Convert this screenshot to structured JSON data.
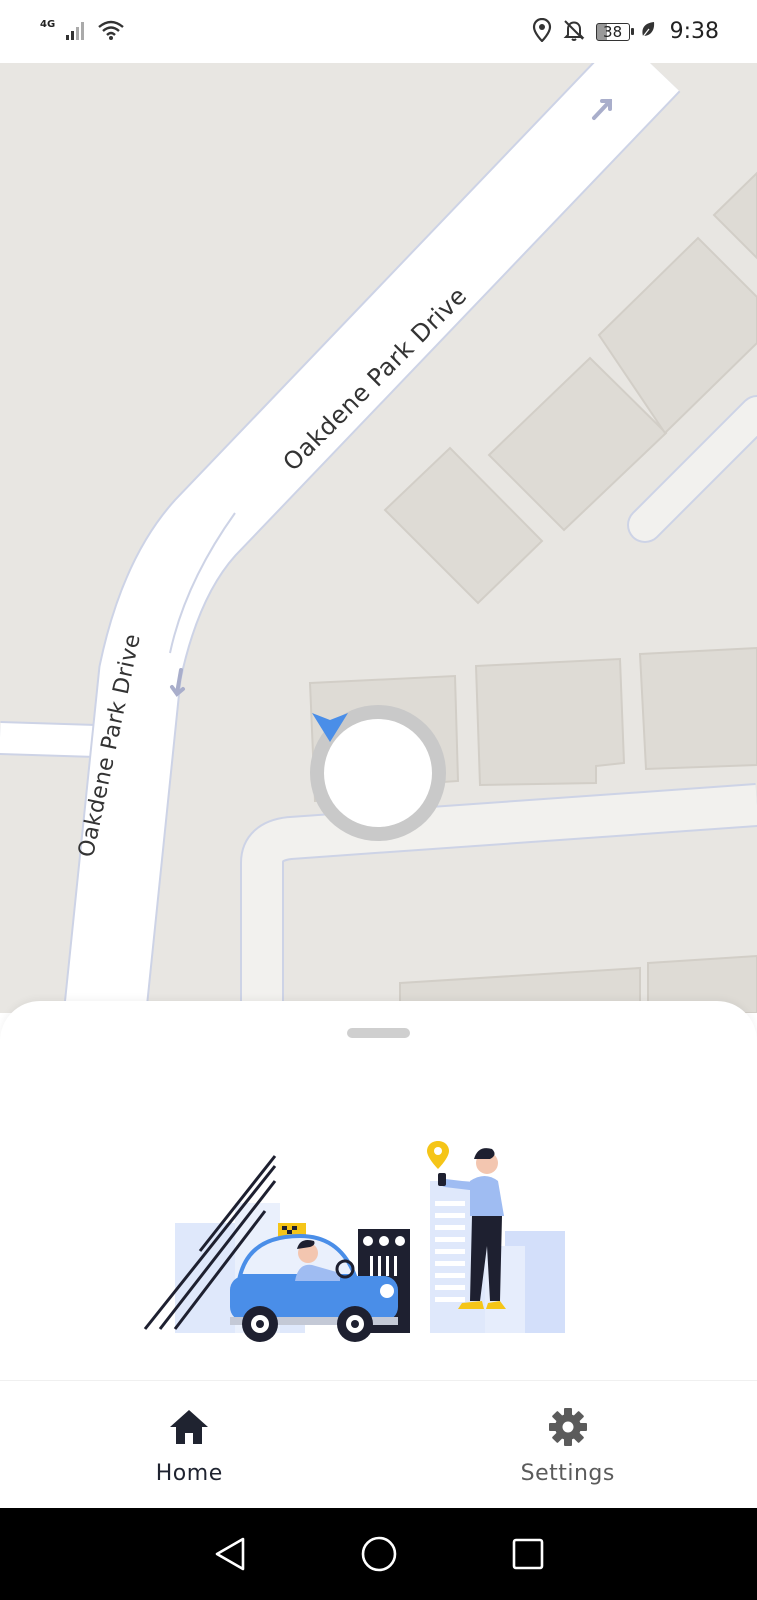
{
  "status_bar": {
    "network_type": "4G",
    "battery_level": "38",
    "time": "9:38",
    "icons": [
      "signal-icon",
      "wifi-icon",
      "location-icon",
      "notifications-off-icon",
      "battery-icon",
      "leaf-icon"
    ]
  },
  "map": {
    "road_labels": [
      "Oakdene Park Drive",
      "Oakdene Park Drive"
    ],
    "colors": {
      "land": "#e8e6e2",
      "building": "#dedbd5",
      "road": "#ffffff",
      "road_edge": "#cdd3e6",
      "location_accent": "#4a8ee8"
    },
    "location_marker_icon": "navigation-arrow-icon"
  },
  "bottom_sheet": {
    "illustration": "taxi-and-passenger-illustration"
  },
  "bottom_nav": {
    "items": [
      {
        "label": "Home",
        "icon": "home-icon",
        "active": true
      },
      {
        "label": "Settings",
        "icon": "settings-gear-icon",
        "active": false
      }
    ]
  },
  "system_nav": {
    "buttons": [
      "back-icon",
      "home-circle-icon",
      "recents-icon"
    ]
  }
}
